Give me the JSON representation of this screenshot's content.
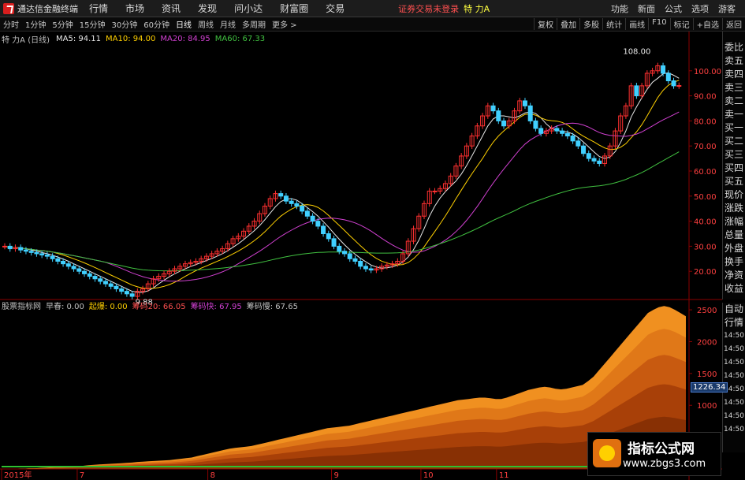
{
  "menubar": {
    "app_title": "通达信金融终端",
    "items": [
      "行情",
      "市场",
      "资讯",
      "发现",
      "问小达",
      "财富圈",
      "交易"
    ],
    "notice": "证券交易未登录",
    "stock": "特 力A",
    "right_items": [
      "功能",
      "新面",
      "公式",
      "选项"
    ],
    "guest": "游客"
  },
  "toolbar": {
    "periods": [
      "分时",
      "1分钟",
      "5分钟",
      "15分钟",
      "30分钟",
      "60分钟",
      "日线",
      "周线",
      "月线",
      "多周期",
      "更多 >"
    ],
    "active": "日线",
    "right": [
      "复权",
      "叠加",
      "多股",
      "统计",
      "画线",
      "F10",
      "标记",
      "+自选",
      "返回"
    ]
  },
  "ma_legend": {
    "stock": "特 力A (日线)",
    "items": [
      {
        "label": "MA5: 94.11",
        "color": "#e8e8e8"
      },
      {
        "label": "MA10: 94.00",
        "color": "#ffd000"
      },
      {
        "label": "MA20: 84.95",
        "color": "#d040d0"
      },
      {
        "label": "MA60: 67.33",
        "color": "#40c040"
      }
    ]
  },
  "side_labels": [
    "委比",
    "卖五",
    "卖四",
    "卖三",
    "卖二",
    "卖一",
    "买一",
    "买二",
    "买三",
    "买四",
    "买五",
    "现价",
    "涨跌",
    "涨幅",
    "总量",
    "外盘",
    "换手",
    "净资",
    "收益"
  ],
  "side_labels_2": [
    "自动",
    "行情",
    "14:50",
    "14:50",
    "14:50",
    "14:50",
    "14:50",
    "14:50",
    "14:50",
    "14:50"
  ],
  "lr_badge": "L R",
  "indicator_legend": {
    "name": "股票指标网",
    "items": [
      {
        "label": "早春: 0.00",
        "color": "#c0c0c0"
      },
      {
        "label": "起爆: 0.00",
        "color": "#ffd000"
      },
      {
        "label": "筹码20: 66.05",
        "color": "#ff5050"
      },
      {
        "label": "筹码快: 67.95",
        "color": "#d040d0"
      },
      {
        "label": "筹码慢: 67.65",
        "color": "#c0c0c0"
      }
    ]
  },
  "price_tag": "1226.34",
  "annotations": {
    "high": "108.00",
    "low": "9.88"
  },
  "dates": [
    "2015年",
    "7",
    "8",
    "9",
    "10",
    "11"
  ],
  "watermark": {
    "title": "指标公式网",
    "url": "www.zbgs3.com"
  },
  "chart_data": [
    {
      "type": "candlestick",
      "title": "特 力A (日线)",
      "ylim": [
        10,
        110
      ],
      "y_ticks": [
        20,
        30,
        40,
        50,
        60,
        70,
        80,
        90,
        100
      ],
      "y_tick_labels": [
        "20.00",
        "30.00",
        "40.00",
        "50.00",
        "60.00",
        "70.00",
        "80.00",
        "90.00",
        "100.00"
      ],
      "closes": [
        30,
        29,
        29.5,
        28.5,
        28,
        27.5,
        27,
        26.5,
        26,
        25,
        24,
        23,
        22,
        21,
        20,
        19,
        18,
        17,
        16,
        15,
        14,
        13,
        12,
        11,
        10,
        12,
        13,
        15,
        17,
        18,
        19,
        20,
        21,
        22,
        23,
        23.5,
        24,
        25,
        26,
        27,
        28,
        29,
        31,
        33,
        34,
        36,
        38,
        40,
        43,
        46,
        49,
        51,
        50,
        48,
        47,
        46,
        44,
        42,
        40,
        38,
        35,
        33,
        30,
        28,
        27,
        25,
        24,
        22,
        21,
        20.5,
        21,
        22,
        22.5,
        23,
        24,
        27,
        32,
        37,
        42,
        47,
        52,
        52,
        53,
        55,
        58,
        62,
        66,
        70,
        74,
        78,
        82,
        86,
        84,
        80,
        78,
        80,
        84,
        88,
        86,
        80,
        77,
        75,
        76,
        77,
        76,
        75,
        74,
        72,
        70,
        67,
        65,
        64,
        63,
        66,
        70,
        76,
        82,
        86,
        94,
        90,
        94,
        99,
        100,
        102,
        99,
        96,
        94,
        94.11
      ],
      "ma5_last": 94.11,
      "ma10_last": 94.0,
      "ma20_last": 84.95,
      "ma60_last": 67.33
    },
    {
      "type": "area",
      "title": "股票指标网",
      "ylim": [
        0,
        2600
      ],
      "y_ticks": [
        1000,
        1500,
        2000,
        2500
      ],
      "y_tick_labels": [
        "1000",
        "1500",
        "2000",
        "2500"
      ],
      "values": [
        0,
        0,
        0,
        0,
        5,
        10,
        10,
        15,
        20,
        25,
        30,
        30,
        35,
        40,
        45,
        50,
        60,
        65,
        70,
        75,
        80,
        85,
        90,
        95,
        100,
        110,
        115,
        120,
        125,
        130,
        135,
        140,
        150,
        160,
        170,
        180,
        200,
        220,
        240,
        260,
        280,
        300,
        320,
        330,
        340,
        350,
        360,
        380,
        400,
        420,
        440,
        460,
        480,
        500,
        520,
        540,
        560,
        580,
        600,
        620,
        640,
        650,
        660,
        670,
        680,
        700,
        720,
        740,
        760,
        780,
        800,
        820,
        840,
        860,
        880,
        900,
        920,
        940,
        960,
        980,
        1000,
        1020,
        1040,
        1060,
        1080,
        1090,
        1100,
        1110,
        1120,
        1120,
        1110,
        1100,
        1100,
        1120,
        1150,
        1180,
        1210,
        1240,
        1260,
        1280,
        1290,
        1280,
        1260,
        1250,
        1260,
        1280,
        1300,
        1320,
        1380,
        1450,
        1550,
        1650,
        1750,
        1850,
        1950,
        2050,
        2150,
        2250,
        2350,
        2450,
        2500,
        2540,
        2560,
        2540,
        2500,
        2450,
        2400
      ]
    }
  ]
}
